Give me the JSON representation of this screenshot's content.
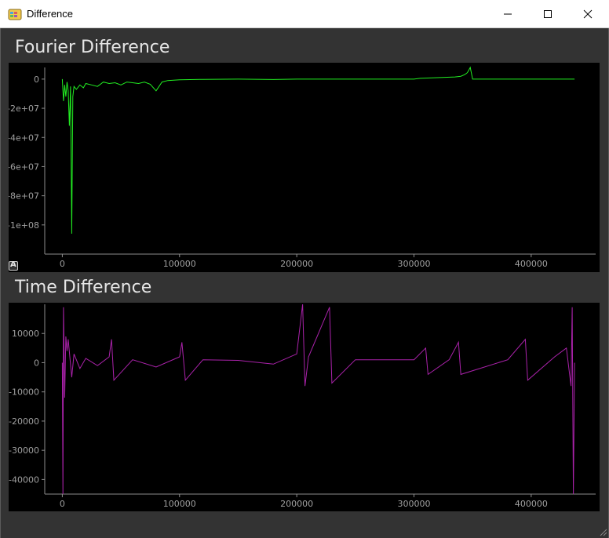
{
  "window": {
    "title": "Difference",
    "icon": "app-palette-icon",
    "controls": [
      "minimize-icon",
      "maximize-icon",
      "close-icon"
    ]
  },
  "colors": {
    "fourier": "#22ee22",
    "time": "#aa22aa",
    "background": "#000000",
    "panel": "#333333"
  },
  "panels": [
    {
      "title": "Fourier Difference"
    },
    {
      "title": "Time Difference"
    }
  ],
  "auto_button": {
    "label": "A"
  },
  "chart_data": [
    {
      "type": "line",
      "title": "Fourier Difference",
      "xlim": [
        -15000,
        455000
      ],
      "ylim": [
        -120000000,
        8000000
      ],
      "xticks": [
        0,
        100000,
        200000,
        300000,
        400000
      ],
      "xtick_labels": [
        "0",
        "100000",
        "200000",
        "300000",
        "400000"
      ],
      "yticks": [
        0,
        -20000000,
        -40000000,
        -60000000,
        -80000000,
        -100000000
      ],
      "ytick_labels": [
        "0",
        "-2e+07",
        "-4e+07",
        "-6e+07",
        "-8e+07",
        "-1e+08"
      ],
      "grid": false,
      "series": [
        {
          "x": [
            0,
            1000,
            2000,
            3000,
            4000,
            5000,
            6000,
            7000,
            8000,
            9000,
            10000,
            12000,
            15000,
            18000,
            20000,
            25000,
            30000,
            35000,
            40000,
            45000,
            50000,
            55000,
            60000,
            65000,
            70000,
            75000,
            80000,
            85000,
            90000,
            100000,
            120000,
            150000,
            180000,
            200000,
            250000,
            300000,
            305000,
            320000,
            335000,
            340000,
            343000,
            345000,
            346000,
            348000,
            350000,
            400000,
            437000
          ],
          "y": [
            0,
            -15000000,
            -4000000,
            -12000000,
            -2000000,
            -8000000,
            -32000000,
            -5000000,
            -106000000,
            -12000000,
            -5000000,
            -7000000,
            -4000000,
            -6000000,
            -3000000,
            -4000000,
            -5000000,
            -2000000,
            -3000000,
            -2500000,
            -4000000,
            -2000000,
            -2500000,
            -3000000,
            -2000000,
            -3500000,
            -8000000,
            -2000000,
            -1000000,
            -500000,
            -200000,
            0,
            -300000,
            0,
            0,
            0,
            500000,
            1000000,
            1500000,
            2000000,
            3000000,
            4000000,
            5000000,
            8000000,
            0,
            0,
            0
          ]
        }
      ]
    },
    {
      "type": "line",
      "title": "Time Difference",
      "xlim": [
        -15000,
        455000
      ],
      "ylim": [
        -45000,
        20000
      ],
      "xticks": [
        0,
        100000,
        200000,
        300000,
        400000
      ],
      "xtick_labels": [
        "0",
        "100000",
        "200000",
        "300000",
        "400000"
      ],
      "yticks": [
        10000,
        0,
        -10000,
        -20000,
        -30000,
        -40000
      ],
      "ytick_labels": [
        "10000",
        "0",
        "-10000",
        "-20000",
        "-30000",
        "-40000"
      ],
      "grid": false,
      "series": [
        {
          "x": [
            0,
            500,
            1000,
            2000,
            3000,
            4000,
            5000,
            8000,
            10000,
            15000,
            20000,
            30000,
            40000,
            42000,
            44000,
            60000,
            80000,
            100000,
            102000,
            105000,
            120000,
            150000,
            180000,
            200000,
            205000,
            207000,
            210000,
            228000,
            230000,
            250000,
            300000,
            310000,
            312000,
            330000,
            338000,
            340000,
            380000,
            395000,
            397000,
            420000,
            430000,
            434000,
            435000,
            436000,
            437000
          ],
          "y": [
            0,
            -45000,
            19000,
            -12000,
            9000,
            4000,
            8000,
            -5000,
            3000,
            -2000,
            1500,
            -1000,
            2000,
            8000,
            -6000,
            1000,
            -1500,
            2000,
            7000,
            -6000,
            1000,
            800,
            -500,
            3000,
            20000,
            -8000,
            2000,
            19000,
            -7000,
            1000,
            1000,
            5000,
            -4000,
            1000,
            7000,
            -4000,
            1000,
            8000,
            -6000,
            2000,
            5000,
            -8000,
            19000,
            -45000,
            0
          ]
        }
      ]
    }
  ]
}
